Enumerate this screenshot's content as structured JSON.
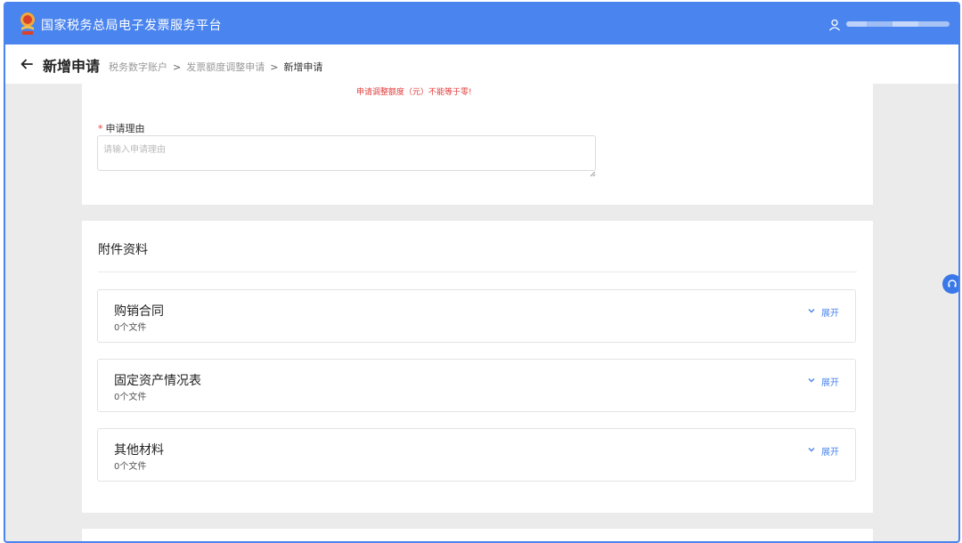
{
  "header": {
    "title": "国家税务总局电子发票服务平台",
    "logo_icon": "tax-emblem-icon",
    "user_icon": "user-icon",
    "colors": {
      "bar": "#4a84ee",
      "accent": "#3a78e8",
      "error": "#e23b3b"
    }
  },
  "subheader": {
    "back_icon": "arrow-left-icon",
    "title": "新增申请",
    "breadcrumb": {
      "items": [
        "税务数字账户",
        "发票额度调整申请",
        "新增申请"
      ],
      "separator": ">"
    }
  },
  "form": {
    "error_message": "申请调整额度（元）不能等于零!",
    "reason_label_required": "*",
    "reason_label": "申请理由",
    "reason_placeholder": "请输入申请理由",
    "reason_value": ""
  },
  "attachments": {
    "title": "附件资料",
    "items": [
      {
        "name": "购销合同",
        "count": "0个文件",
        "action": "展开"
      },
      {
        "name": "固定资产情况表",
        "count": "0个文件",
        "action": "展开"
      },
      {
        "name": "其他材料",
        "count": "0个文件",
        "action": "展开"
      }
    ]
  },
  "floating": {
    "support_icon": "headset-icon"
  }
}
